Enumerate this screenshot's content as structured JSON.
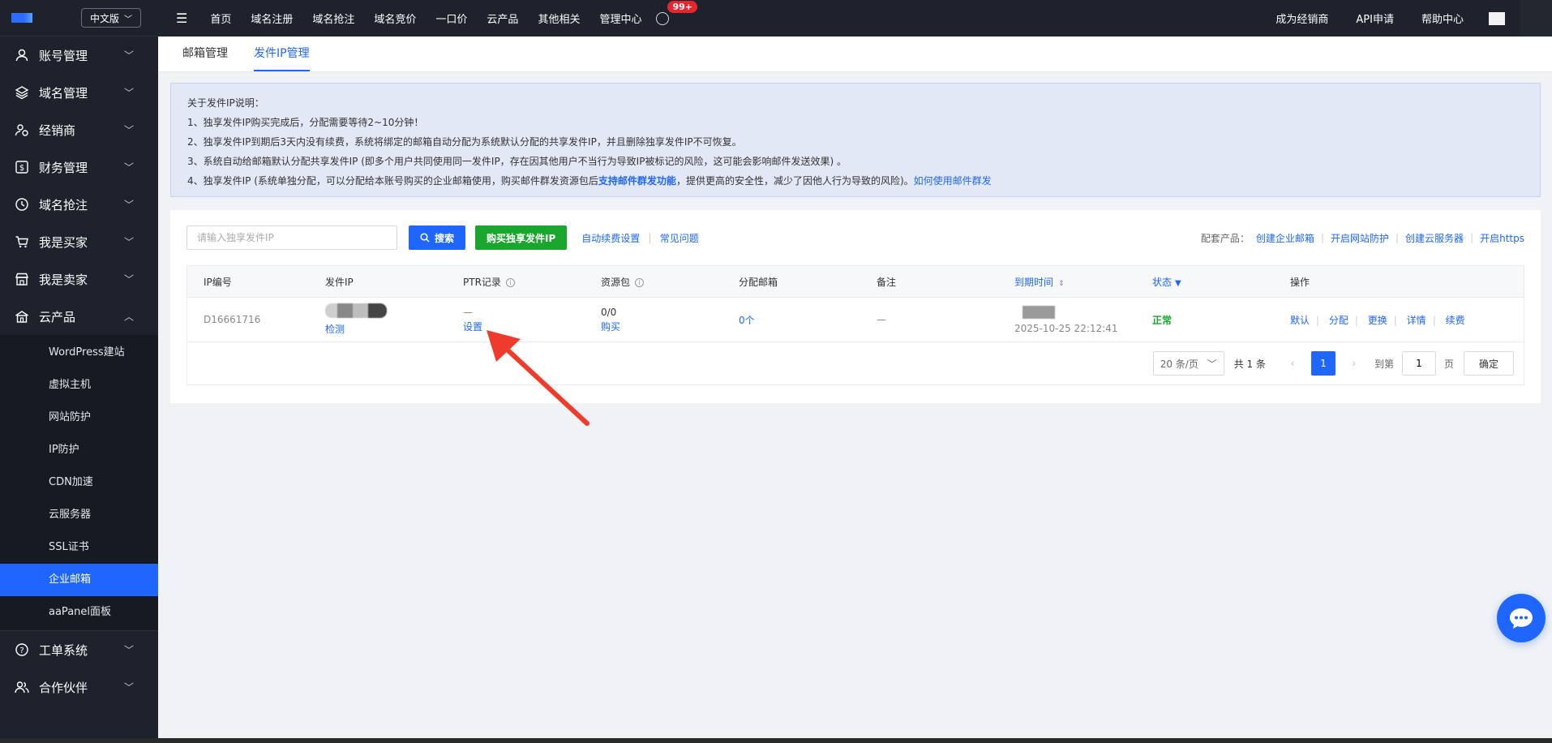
{
  "header": {
    "lang": "中文版",
    "nav": [
      "首页",
      "域名注册",
      "域名抢注",
      "域名竞价",
      "一口价",
      "云产品",
      "其他相关",
      "管理中心"
    ],
    "badge": "99+",
    "right_links": [
      "成为经销商",
      "API申请",
      "帮助中心"
    ]
  },
  "sidebar": {
    "items": [
      {
        "label": "账号管理",
        "icon": "user-icon"
      },
      {
        "label": "域名管理",
        "icon": "layers-icon"
      },
      {
        "label": "经销商",
        "icon": "dealer-icon"
      },
      {
        "label": "财务管理",
        "icon": "finance-icon"
      },
      {
        "label": "域名抢注",
        "icon": "clock-icon"
      },
      {
        "label": "我是买家",
        "icon": "cart-icon"
      },
      {
        "label": "我是卖家",
        "icon": "shop-icon"
      },
      {
        "label": "云产品",
        "icon": "cloud-icon"
      }
    ],
    "sub_items": [
      "WordPress建站",
      "虚拟主机",
      "网站防护",
      "IP防护",
      "CDN加速",
      "云服务器",
      "SSL证书",
      "企业邮箱",
      "aaPanel面板"
    ],
    "active_sub": "企业邮箱",
    "bottom_items": [
      {
        "label": "工单系统",
        "icon": "help-icon"
      },
      {
        "label": "合作伙伴",
        "icon": "partner-icon"
      }
    ]
  },
  "tabs": [
    "邮箱管理",
    "发件IP管理"
  ],
  "active_tab": "发件IP管理",
  "notice": {
    "title": "关于发件IP说明：",
    "line1": "1、独享发件IP购买完成后，分配需要等待2~10分钟！",
    "line2": "2、独享发件IP到期后3天内没有续费，系统将绑定的邮箱自动分配为系统默认分配的共享发件IP，并且删除独享发件IP不可恢复。",
    "line3": "3、系统自动给邮箱默认分配共享发件IP (即多个用户共同使用同一发件IP，存在因其他用户不当行为导致IP被标记的风险，这可能会影响邮件发送效果) 。",
    "line4_a": "4、独享发件IP (系统单独分配，可以分配给本账号购买的企业邮箱使用，购买邮件群发资源包后",
    "line4_link": "支持邮件群发功能",
    "line4_b": "，提供更高的安全性，减少了因他人行为导致的风险)。",
    "line4_link2": "如何使用邮件群发"
  },
  "toolbar": {
    "search_placeholder": "请输入独享发件IP",
    "search_btn": "搜索",
    "buy_btn": "购买独享发件IP",
    "link1": "自动续费设置",
    "link2": "常见问题",
    "related_label": "配套产品：",
    "related": [
      "创建企业邮箱",
      "开启网站防护",
      "创建云服务器",
      "开启https"
    ]
  },
  "table": {
    "headers": [
      "IP编号",
      "发件IP",
      "PTR记录",
      "资源包",
      "分配邮箱",
      "备注",
      "到期时间",
      "状态",
      "操作"
    ],
    "row": {
      "id": "D16661716",
      "ip_action": "检测",
      "ptr": "—",
      "ptr_action": "设置",
      "pkg": "0/0",
      "pkg_action": "购买",
      "mailbox": "0个",
      "remark": "—",
      "expire": "2025-10-25 22:12:41",
      "status": "正常",
      "ops": [
        "默认",
        "分配",
        "更换",
        "详情",
        "续费"
      ]
    }
  },
  "pager": {
    "page_size": "20 条/页",
    "total": "共 1 条",
    "current": "1",
    "goto_label": "到第",
    "goto_value": "1",
    "page_unit": "页",
    "ok": "确定"
  }
}
